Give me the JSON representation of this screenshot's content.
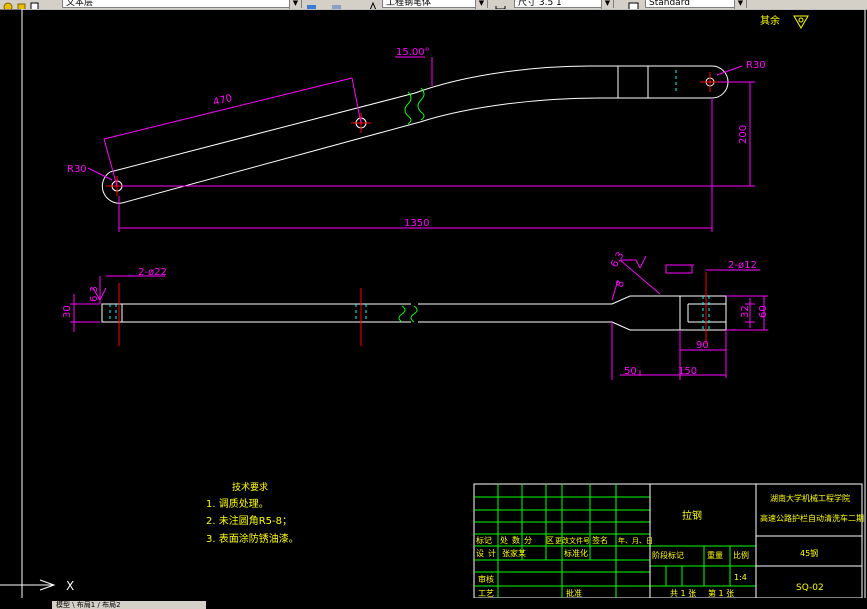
{
  "toolbar": {
    "layer_name": "文本层",
    "text_style": "工程钢笔体",
    "dim_style": "尺寸 3.5 1",
    "table_style": "Standard"
  },
  "drawing": {
    "top_view": {
      "dim_angle": "15.00°",
      "dim_length_470": "470",
      "dim_r30_left": "R30",
      "dim_r30_right": "R30",
      "dim_200": "200",
      "dim_1350": "1350"
    },
    "side_view": {
      "dim_2phi22": "2-ø22",
      "dim_2phi12": "2-ø12",
      "dim_30": "30",
      "dim_roughness_left": "6.3",
      "dim_roughness_right": "6.3",
      "dim_8": "8",
      "dim_32": "32",
      "dim_60": "60",
      "dim_90": "90",
      "dim_50": "50",
      "dim_150": "150"
    },
    "corner_note": "其余"
  },
  "notes": {
    "title": "技术要求",
    "items": [
      "1. 调质处理。",
      "2. 未注圆角R5-8；",
      "3. 表面涂防锈油漆。"
    ]
  },
  "title_block": {
    "part_name": "拉钢",
    "school": "湖南大学机械工程学院",
    "project": "高速公路护栏自动清洗车二期",
    "rev_header": [
      "标",
      "记",
      "处",
      "数",
      "分",
      "区",
      "更改文件号",
      "签名",
      "年、月、日"
    ],
    "row_design": [
      "设",
      "计",
      "张家某",
      "标准化"
    ],
    "stage_header": [
      "阶段标记",
      "重量",
      "比例"
    ],
    "scale": "1:4",
    "sheets": "共 1 张",
    "sheet_no": "第 1 张",
    "review": "审核",
    "process": "工艺",
    "approve": "批准",
    "material": "45钢",
    "drawing_no": "SQ-02"
  },
  "ucs": {
    "x_label": "X"
  },
  "command_tab": "模型 \\ 布局1 / 布局2"
}
